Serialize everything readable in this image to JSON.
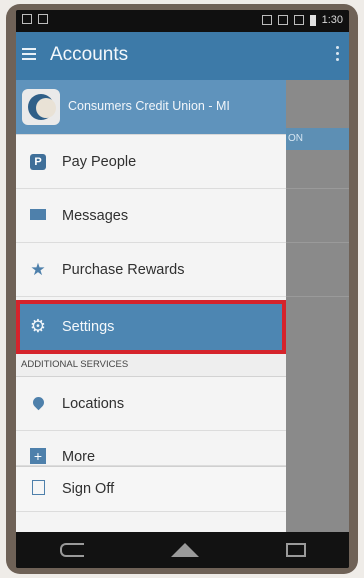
{
  "status_bar": {
    "time": "1:30"
  },
  "app_bar": {
    "title": "Accounts"
  },
  "background": {
    "button_fragment": "ON"
  },
  "drawer": {
    "header": {
      "institution": "Consumers Credit Union - MI"
    },
    "items": [
      {
        "label": "Pay People",
        "icon": "pay-people-icon"
      },
      {
        "label": "Messages",
        "icon": "mail-icon"
      },
      {
        "label": "Purchase Rewards",
        "icon": "star-icon"
      },
      {
        "label": "Settings",
        "icon": "gear-icon",
        "highlighted": true
      }
    ],
    "section_label": "ADDITIONAL SERVICES",
    "additional_items": [
      {
        "label": "Locations",
        "icon": "location-pin-icon"
      },
      {
        "label": "More",
        "icon": "plus-icon"
      }
    ],
    "footer": {
      "label": "Sign Off",
      "icon": "sign-off-icon"
    }
  },
  "colors": {
    "app_bar": "#3d7aa8",
    "drawer_header": "#5f93bc",
    "selected_item": "#4d86b2",
    "highlight_outline": "#d5232b",
    "frame": "#6f6257"
  }
}
